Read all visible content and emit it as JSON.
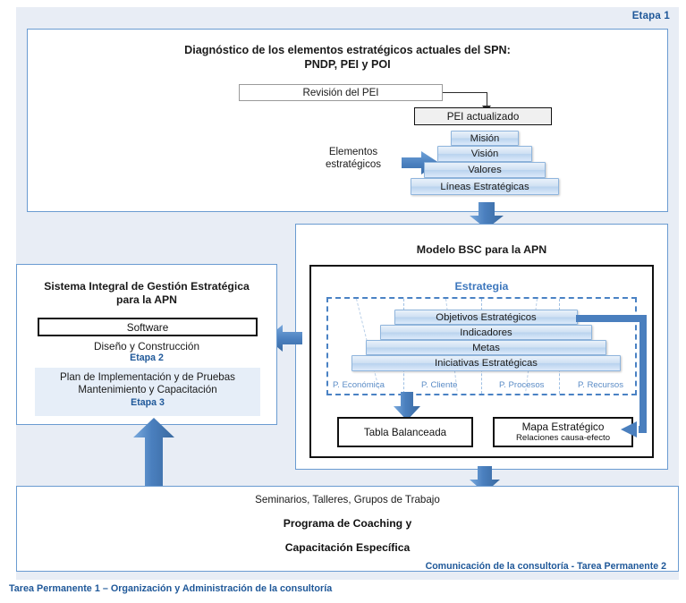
{
  "stage1": {
    "badge": "Etapa 1",
    "title_line1": "Diagnóstico de los elementos estratégicos actuales del SPN:",
    "title_line2": "PNDP, PEI y POI",
    "revision_box": "Revisión del PEI",
    "pei_box": "PEI actualizado",
    "elementos_line1": "Elementos",
    "elementos_line2": "estratégicos",
    "pyramid": [
      {
        "label": "Misión"
      },
      {
        "label": "Visión"
      },
      {
        "label": "Valores"
      },
      {
        "label": "Líneas Estratégicas"
      }
    ]
  },
  "bsc": {
    "title": "Modelo BSC para la APN",
    "strategy_label": "Estrategia",
    "pyramid": [
      {
        "label": "Objetivos Estratégicos"
      },
      {
        "label": "Indicadores"
      },
      {
        "label": "Metas"
      },
      {
        "label": "Iniciativas Estratégicas"
      }
    ],
    "perspectives": [
      {
        "label": "P. Económica"
      },
      {
        "label": "P. Cliente"
      },
      {
        "label": "P. Procesos"
      },
      {
        "label": "P. Recursos"
      }
    ],
    "tabla_balanceada": "Tabla Balanceada",
    "mapa_title": "Mapa Estratégico",
    "mapa_subtitle": "Relaciones causa-efecto"
  },
  "sistema": {
    "title_line1": "Sistema Integral de Gestión Estratégica",
    "title_line2": "para la APN",
    "software": "Software",
    "diseno": "Diseño y Construcción",
    "etapa2": "Etapa 2",
    "plan_line1": "Plan de Implementación y de Pruebas",
    "plan_line2": "Mantenimiento y Capacitación",
    "etapa3": "Etapa 3"
  },
  "bottom": {
    "seminarios": "Seminarios, Talleres, Grupos de Trabajo",
    "programa": "Programa de Coaching y",
    "capacitacion": "Capacitación Específica",
    "comunicacion": "Comunicación de la consultoría - Tarea Permanente 2"
  },
  "footer": {
    "tarea1": "Tarea Permanente 1  – Organización y Administración de la consultoría"
  },
  "colors": {
    "accent_blue": "#1f5899",
    "panel_border": "#6a9bd1",
    "band_bg": "#e8edf5",
    "arrow_blue": "#4a7fbe",
    "strategy_blue": "#3d77bd",
    "perspective_blue": "#5b8cc6"
  }
}
